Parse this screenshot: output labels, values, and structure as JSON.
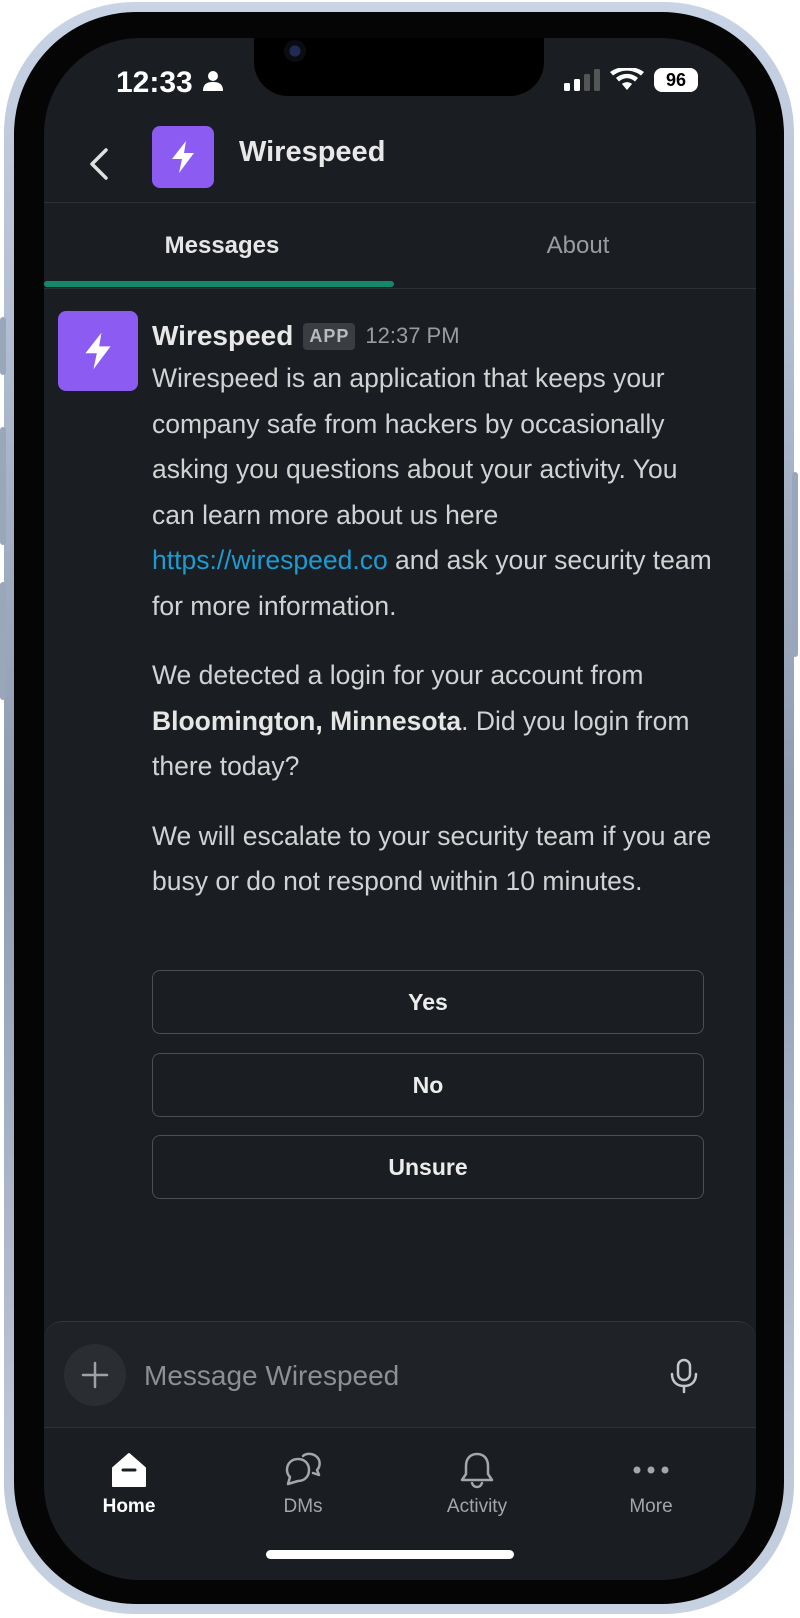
{
  "status_bar": {
    "time": "12:33",
    "battery": "96"
  },
  "header": {
    "title": "Wirespeed",
    "back_icon": "chevron-left-icon",
    "app_icon": "lightning-bolt-icon"
  },
  "tabs": [
    {
      "label": "Messages",
      "active": true
    },
    {
      "label": "About",
      "active": false
    }
  ],
  "message": {
    "sender": "Wirespeed",
    "badge": "APP",
    "time": "12:37 PM",
    "para1_before_link": "Wirespeed is an application that keeps your company safe from hackers by occasionally asking you questions about your activity. You can learn more about us here ",
    "link": "https://wirespeed.co",
    "para1_after_link": " and ask your security team for more information.",
    "para2_before": "We detected a login for your account from ",
    "para2_location": "Bloomington, Minnesota",
    "para2_after": ". Did you login from there today?",
    "para3": "We will escalate to your security team if you are busy or do not respond within 10 minutes."
  },
  "actions": [
    {
      "label": "Yes"
    },
    {
      "label": "No"
    },
    {
      "label": "Unsure"
    }
  ],
  "composer": {
    "placeholder": "Message Wirespeed",
    "plus_icon": "plus-icon",
    "mic_icon": "microphone-icon"
  },
  "bottom_nav": [
    {
      "label": "Home",
      "icon": "home-icon",
      "active": true
    },
    {
      "label": "DMs",
      "icon": "dms-icon",
      "active": false
    },
    {
      "label": "Activity",
      "icon": "bell-icon",
      "active": false
    },
    {
      "label": "More",
      "icon": "more-icon",
      "active": false
    }
  ],
  "colors": {
    "background": "#1a1d21",
    "accent_purple": "#8c5cf2",
    "tab_underline": "#14886a",
    "link": "#1d9bd1"
  }
}
